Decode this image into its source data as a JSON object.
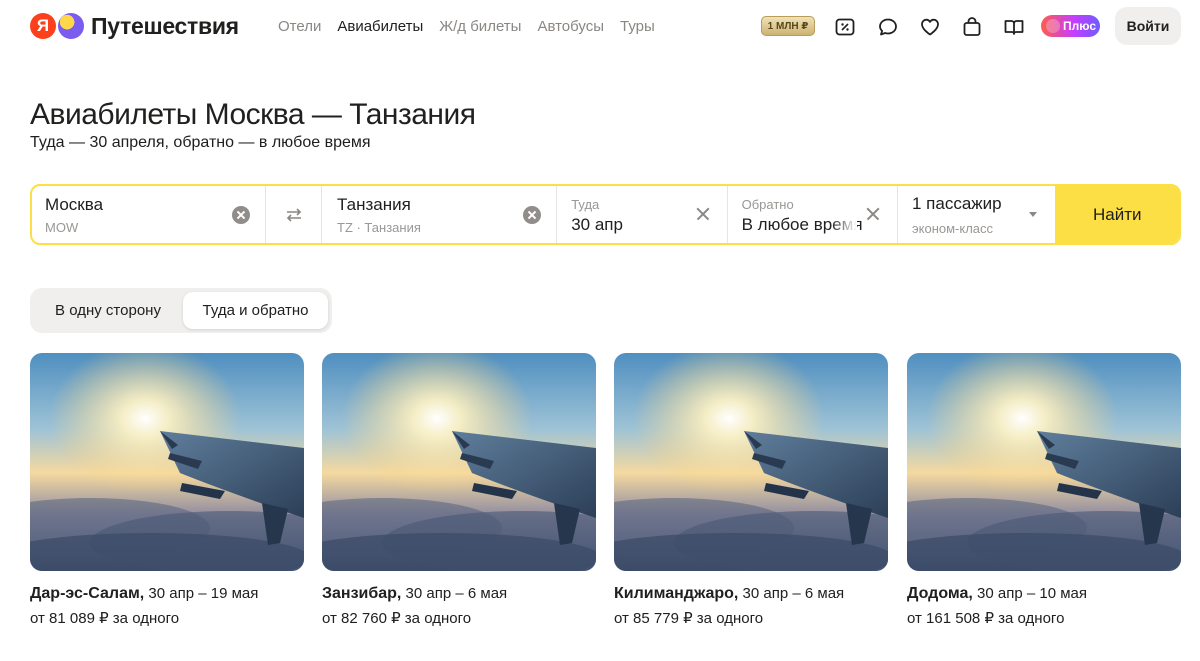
{
  "header": {
    "logo_letter": "Я",
    "logo_text": "Путешествия",
    "nav": [
      {
        "label": "Отели",
        "active": false
      },
      {
        "label": "Авиабилеты",
        "active": true
      },
      {
        "label": "Ж/д билеты",
        "active": false
      },
      {
        "label": "Автобусы",
        "active": false
      },
      {
        "label": "Туры",
        "active": false
      }
    ],
    "mln_badge": "1 МЛН ₽",
    "plus_label": "Плюс",
    "login_label": "Войти"
  },
  "page": {
    "title": "Авиабилеты Москва — Танзания",
    "subtitle": "Туда — 30 апреля, обратно — в любое время"
  },
  "search": {
    "from_value": "Москва",
    "from_code": "MOW",
    "to_value": "Танзания",
    "to_code": "TZ · Танзания",
    "there_label": "Туда",
    "there_value": "30 апр",
    "back_label": "Обратно",
    "back_value": "В любое время",
    "passengers_value": "1 пассажир",
    "class_value": "эконом-класс",
    "find_label": "Найти"
  },
  "trip_toggle": {
    "one_way": "В одну сторону",
    "round_trip": "Туда и обратно",
    "selected": "round_trip"
  },
  "cards": [
    {
      "city": "Дар-эс-Салам,",
      "dates": "30 апр – 19 мая",
      "price": "от 81 089 ₽ за одного"
    },
    {
      "city": "Занзибар,",
      "dates": "30 апр – 6 мая",
      "price": "от 82 760 ₽ за одного"
    },
    {
      "city": "Килиманджаро,",
      "dates": "30 апр – 6 мая",
      "price": "от 85 779 ₽ за одного"
    },
    {
      "city": "Додома,",
      "dates": "30 апр – 10 мая",
      "price": "от 161 508 ₽ за одного"
    }
  ],
  "colors": {
    "accent_yellow": "#fcdf44",
    "logo_red": "#fc3f1d"
  }
}
